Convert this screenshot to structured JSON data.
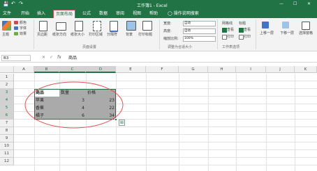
{
  "window": {
    "title": "工作簿1 - Excel",
    "controls": [
      "—",
      "☐",
      "✕"
    ]
  },
  "quick_access": {
    "save": "💾",
    "undo": "↶",
    "redo": "↷"
  },
  "tabs": [
    "文件",
    "开始",
    "插入",
    "页面布局",
    "公式",
    "数据",
    "审阅",
    "视图",
    "帮助",
    "操作说明搜索"
  ],
  "active_tab": "页面布局",
  "ribbon": {
    "theme_group": {
      "big_button": "主题",
      "items": [
        "颜色",
        "字体",
        "效果"
      ]
    },
    "page_setup_group": {
      "buttons": [
        "页边距",
        "纸张方向",
        "纸张大小",
        "打印区域",
        "分隔符",
        "背景",
        "打印标题"
      ],
      "label": "页面设置"
    },
    "scale_group": {
      "rows": [
        {
          "label": "宽度:",
          "value": "自动"
        },
        {
          "label": "高度:",
          "value": "自动"
        },
        {
          "label": "缩放比例:",
          "value": "100%"
        }
      ],
      "label": "调整为合适大小"
    },
    "sheet_options_group": {
      "col1": "网格线",
      "col2": "标题",
      "view": "查看",
      "print": "打印",
      "label": "工作表选项"
    },
    "arrange_group": {
      "buttons": [
        "上移一层",
        "下移一层",
        "选择窗格"
      ]
    }
  },
  "formula_bar": {
    "name_box": "B3",
    "cancel": "✕",
    "enter": "✓",
    "fx": "fx",
    "value": "商品"
  },
  "columns": [
    "A",
    "B",
    "C",
    "D",
    "E",
    "F",
    "G",
    "H",
    "I",
    "J",
    "K"
  ],
  "rows": [
    "1",
    "2",
    "3",
    "4",
    "5",
    "6",
    "7",
    "8",
    "9",
    "10",
    "11",
    "12"
  ],
  "table": {
    "headers": [
      "商品",
      "数量",
      "价格"
    ],
    "data": [
      [
        "苹果",
        "3",
        "23"
      ],
      [
        "香蕉",
        "4",
        "22"
      ],
      [
        "橘子",
        "6",
        "34"
      ]
    ]
  },
  "quick_analysis": "⊞",
  "colors": {
    "brand": "#217346",
    "selection_fill": "#aaaaaa",
    "annotation": "#e05050"
  }
}
